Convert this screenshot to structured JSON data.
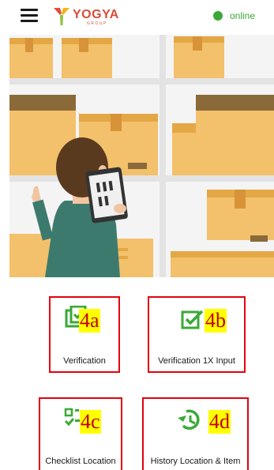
{
  "header": {
    "logo_text": "YOGYA",
    "logo_subtext": "GROUP",
    "status_text": "online",
    "status_color": "#3aa935"
  },
  "hero": {
    "illustration": "warehouse-worker-with-tablet"
  },
  "menu": {
    "items": [
      {
        "label": "Verification",
        "badge": "4a",
        "icon": "verification-icon"
      },
      {
        "label": "Verification 1X Input",
        "badge": "4b",
        "icon": "checkbox-check-icon"
      },
      {
        "label": "Checklist Location",
        "badge": "4c",
        "icon": "checklist-icon"
      },
      {
        "label": "History Location & Item",
        "badge": "4d",
        "icon": "history-icon"
      }
    ]
  },
  "colors": {
    "accent_green": "#3aa935",
    "badge_bg": "#ffff00",
    "badge_text": "#c00000",
    "tile_border": "#e3000f"
  }
}
